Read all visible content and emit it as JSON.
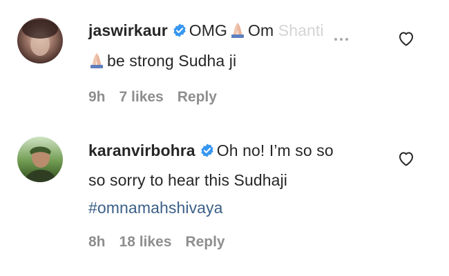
{
  "comments": [
    {
      "username": "jaswirkaur",
      "text_prefix": "OMG",
      "text_mid": "Om",
      "text_faded": "Shanti",
      "text_line2": "be strong Sudha ji",
      "time": "9h",
      "likes": "7 likes",
      "reply": "Reply"
    },
    {
      "username": "karanvirbohra",
      "text_line1": "Oh no! I’m so so",
      "text_line2": "so sorry to hear this Sudhaji",
      "hashtag": "#omnamahshivaya",
      "time": "8h",
      "likes": "18 likes",
      "reply": "Reply"
    }
  ],
  "icons": {
    "verified": "verified-badge-icon",
    "emoji": "praying-hands-emoji",
    "heart": "heart-outline-icon",
    "more": "more-options-icon"
  },
  "colors": {
    "verified_blue": "#3897f0",
    "hashtag": "#3b5f86",
    "meta_gray": "#8e8e8e"
  }
}
